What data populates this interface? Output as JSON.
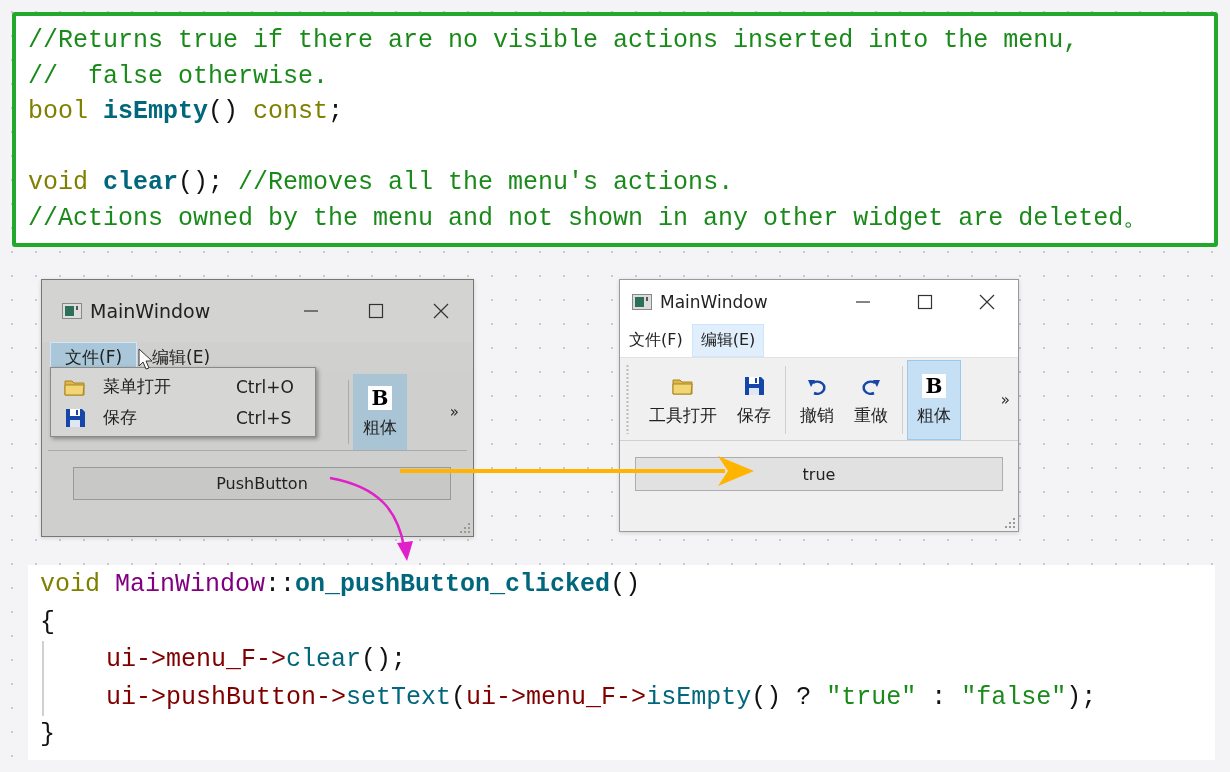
{
  "doc_code": {
    "lines": [
      {
        "tokens": [
          {
            "kind": "comment",
            "text": "//Returns true if there are no visible actions inserted into the menu,"
          }
        ]
      },
      {
        "tokens": [
          {
            "kind": "comment",
            "text": "//  false otherwise."
          }
        ]
      },
      {
        "tokens": [
          {
            "kind": "keyword",
            "text": "bool "
          },
          {
            "kind": "func",
            "text": "isEmpty"
          },
          {
            "kind": "punct",
            "text": "()"
          },
          {
            "kind": "keyword",
            "text": " const"
          },
          {
            "kind": "punct",
            "text": ";"
          }
        ]
      },
      {
        "blank_before": true,
        "tokens": [
          {
            "kind": "keyword",
            "text": "void "
          },
          {
            "kind": "func",
            "text": "clear"
          },
          {
            "kind": "punct",
            "text": "();"
          },
          {
            "kind": "comment",
            "text": " //Removes all the menu's actions."
          }
        ]
      },
      {
        "tokens": [
          {
            "kind": "comment",
            "text": "//Actions owned by the menu and not shown in any other widget are deleted。"
          }
        ]
      }
    ]
  },
  "windows": [
    {
      "kind": "photo",
      "title": "MainWindow",
      "menu_bar": [
        {
          "label": "文件(F)",
          "selected": true
        },
        {
          "label": "编辑(E)",
          "selected": false
        }
      ],
      "dropdown": [
        {
          "kind": "open",
          "label": "菜单打开",
          "shortcut": "Ctrl+O"
        },
        {
          "kind": "save",
          "label": "保存",
          "shortcut": "Ctrl+S"
        }
      ],
      "toolbar": [
        {
          "kind": "separator"
        },
        {
          "kind": "bold",
          "icon_text": "B",
          "label": "粗体",
          "checked": true
        }
      ],
      "overflow": "»",
      "push_button": "PushButton"
    },
    {
      "kind": "screen",
      "title": "MainWindow",
      "menu_bar": [
        {
          "label": "文件(F)",
          "selected": false
        },
        {
          "label": "编辑(E)",
          "selected": true
        }
      ],
      "toolbar": [
        {
          "kind": "open",
          "label": "工具打开",
          "checked": false
        },
        {
          "kind": "save",
          "label": "保存",
          "checked": false
        },
        {
          "kind": "separator"
        },
        {
          "kind": "undo",
          "label": "撤销",
          "checked": false
        },
        {
          "kind": "redo",
          "label": "重做",
          "checked": false
        },
        {
          "kind": "separator"
        },
        {
          "kind": "bold",
          "icon_text": "B",
          "label": "粗体",
          "checked": true
        }
      ],
      "overflow": "»",
      "push_button": "true"
    }
  ],
  "slot_code": {
    "lines": [
      {
        "tokens": [
          {
            "kind": "keyword",
            "text": "void "
          },
          {
            "kind": "class",
            "text": "MainWindow"
          },
          {
            "kind": "punct",
            "text": "::"
          },
          {
            "kind": "func",
            "text": "on_pushButton_clicked"
          },
          {
            "kind": "punct",
            "text": "()"
          }
        ]
      },
      {
        "tokens": [
          {
            "kind": "punct",
            "text": "{"
          }
        ]
      },
      {
        "indented": true,
        "tokens": [
          {
            "kind": "member",
            "text": "ui->menu_F->"
          },
          {
            "kind": "method",
            "text": "clear"
          },
          {
            "kind": "punct",
            "text": "();"
          }
        ]
      },
      {
        "indented": true,
        "tokens": [
          {
            "kind": "member",
            "text": "ui->pushButton->"
          },
          {
            "kind": "method",
            "text": "setText"
          },
          {
            "kind": "punct",
            "text": "("
          },
          {
            "kind": "member",
            "text": "ui->menu_F->"
          },
          {
            "kind": "method",
            "text": "isEmpty"
          },
          {
            "kind": "punct",
            "text": "() ? "
          },
          {
            "kind": "string",
            "text": "\"true\""
          },
          {
            "kind": "punct",
            "text": " : "
          },
          {
            "kind": "string",
            "text": "\"false\""
          },
          {
            "kind": "punct",
            "text": ");"
          }
        ]
      },
      {
        "tokens": [
          {
            "kind": "punct",
            "text": "}"
          }
        ]
      }
    ]
  }
}
